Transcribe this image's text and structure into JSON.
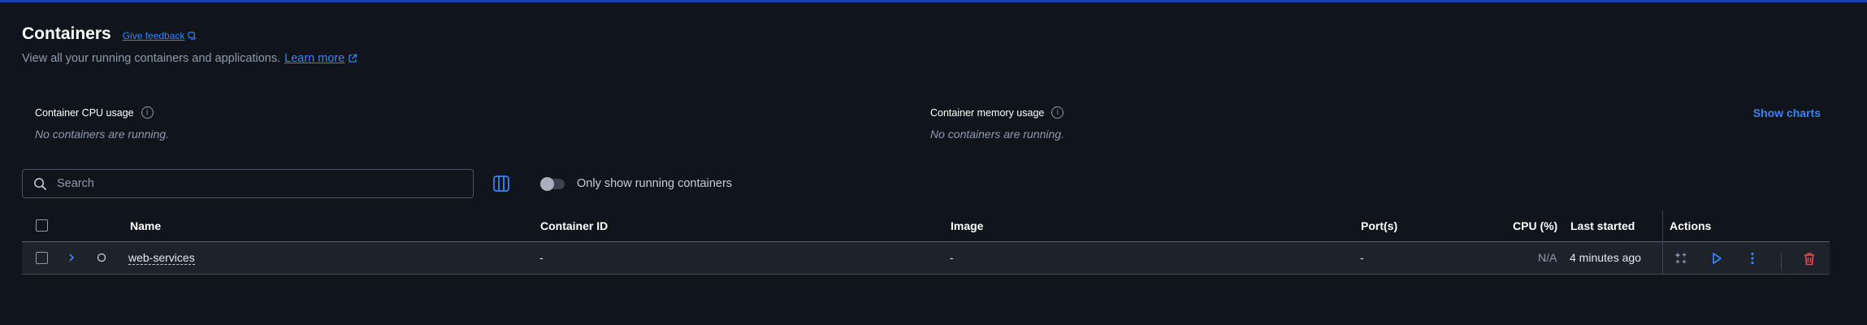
{
  "header": {
    "title": "Containers",
    "feedback_label": "Give feedback",
    "subtitle": "View all your running containers and applications.",
    "learn_more": "Learn more"
  },
  "usage": {
    "cpu_label": "Container CPU usage",
    "cpu_empty": "No containers are running.",
    "memory_label": "Container memory usage",
    "memory_empty": "No containers are running.",
    "show_charts": "Show charts"
  },
  "toolbar": {
    "search_placeholder": "Search",
    "running_toggle_label": "Only show running containers",
    "running_toggle_on": false
  },
  "table": {
    "columns": {
      "name": "Name",
      "container_id": "Container ID",
      "image": "Image",
      "ports": "Port(s)",
      "cpu": "CPU (%)",
      "last_started": "Last started",
      "actions": "Actions"
    },
    "rows": [
      {
        "name": "web-services",
        "container_id": "-",
        "image": "-",
        "ports": "-",
        "cpu": "N/A",
        "last_started": "4 minutes ago"
      }
    ]
  },
  "colors": {
    "background": "#10141b",
    "accent": "#3b82f6",
    "danger": "#e5484d",
    "topbar": "#1b3fa8"
  },
  "icons": [
    "external-link-icon",
    "info-icon",
    "search-icon",
    "columns-icon",
    "chevron-right-icon",
    "status-circle-icon",
    "sparkle-icon",
    "play-icon",
    "more-vertical-icon",
    "trash-icon"
  ]
}
